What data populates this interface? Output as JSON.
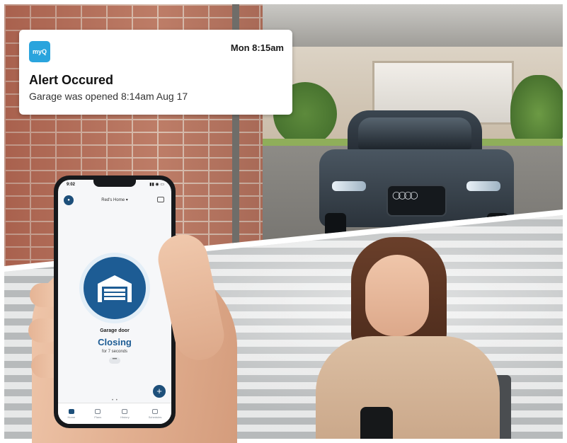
{
  "notification": {
    "app_icon_label": "myQ",
    "time": "Mon 8:15am",
    "title": "Alert Occured",
    "body": "Garage was opened 8:14am Aug 17"
  },
  "phone": {
    "status_time": "9:02",
    "status_icons": "▮▮ ◉ ▭",
    "home_name": "Red's Home ▾",
    "avatar_glyph": "●",
    "device": {
      "name": "Garage door",
      "state": "Closing",
      "detail": "for 7 seconds",
      "more": "•••"
    },
    "page_dots": "• •",
    "fab_label": "+",
    "tabs": [
      {
        "label": "Home"
      },
      {
        "label": "Plans"
      },
      {
        "label": "History"
      },
      {
        "label": "Schedules"
      }
    ]
  },
  "colors": {
    "brand_blue": "#1d5c94",
    "app_icon_blue": "#2aa4dd"
  },
  "icons": [
    "garage-door-icon",
    "plus-icon",
    "message-icon",
    "home-tab-icon",
    "plans-tab-icon",
    "history-tab-icon",
    "schedules-tab-icon"
  ]
}
